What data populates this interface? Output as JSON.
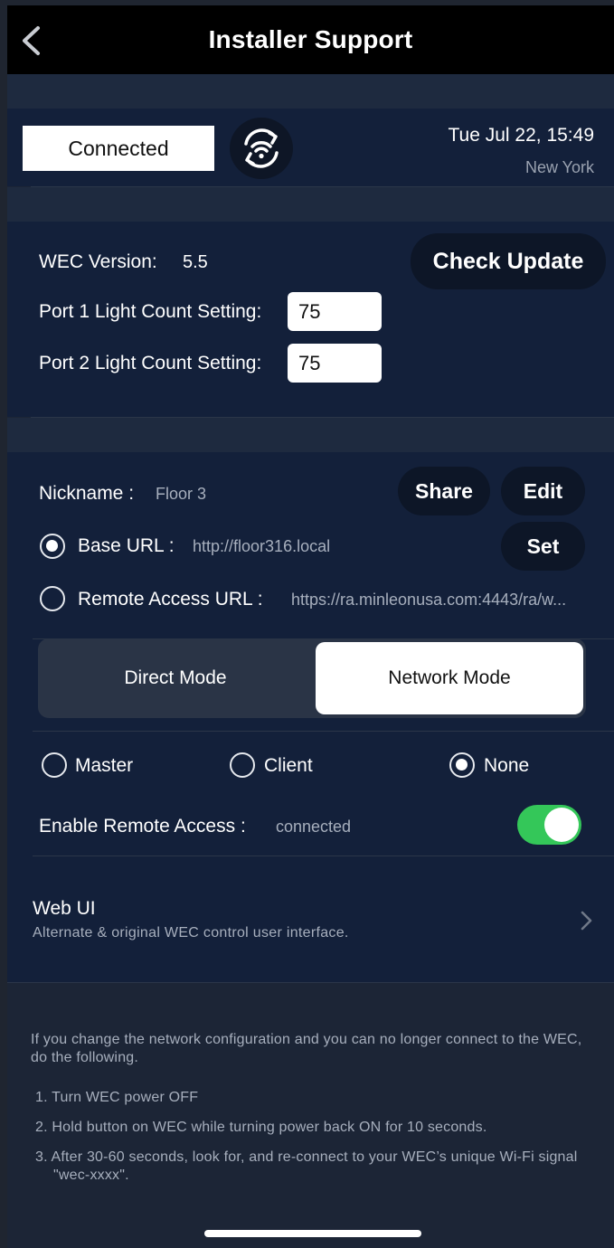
{
  "header": {
    "title": "Installer Support"
  },
  "status": {
    "connection": "Connected",
    "datetime": "Tue Jul 22, 15:49",
    "location": "New York"
  },
  "version": {
    "label": "WEC Version:",
    "value": "5.5",
    "check_update": "Check Update",
    "port1_label": "Port 1 Light Count Setting:",
    "port1_value": "75",
    "port2_label": "Port 2 Light Count Setting:",
    "port2_value": "75"
  },
  "network": {
    "nickname_label": "Nickname :",
    "nickname_value": "Floor 3",
    "share": "Share",
    "edit": "Edit",
    "base_url_label": "Base URL :",
    "base_url_value": "http://floor316.local",
    "set": "Set",
    "remote_url_label": "Remote Access URL :",
    "remote_url_value": "https://ra.minleonusa.com:4443/ra/w...",
    "url_selected": "base",
    "modes": [
      "Direct Mode",
      "Network Mode"
    ],
    "mode_selected": "Network Mode",
    "roles": [
      "Master",
      "Client",
      "None"
    ],
    "role_selected": "None",
    "remote_access_label": "Enable Remote Access :",
    "remote_access_status": "connected",
    "remote_access_enabled": true
  },
  "web_ui": {
    "title": "Web UI",
    "description": "Alternate & original WEC control user interface."
  },
  "instructions": {
    "intro": "If you change the network configuration and you can no longer connect to the WEC, do the following.",
    "steps": [
      "1. Turn WEC power OFF",
      "2. Hold button on WEC while turning power back ON for 10 seconds.",
      "3. After 30-60 seconds, look for, and re-connect to your WEC’s unique Wi-Fi signal \"wec-xxxx\"."
    ]
  },
  "colors": {
    "accent_toggle": "#34c759",
    "card": "#13203a",
    "background": "#1c2536"
  }
}
